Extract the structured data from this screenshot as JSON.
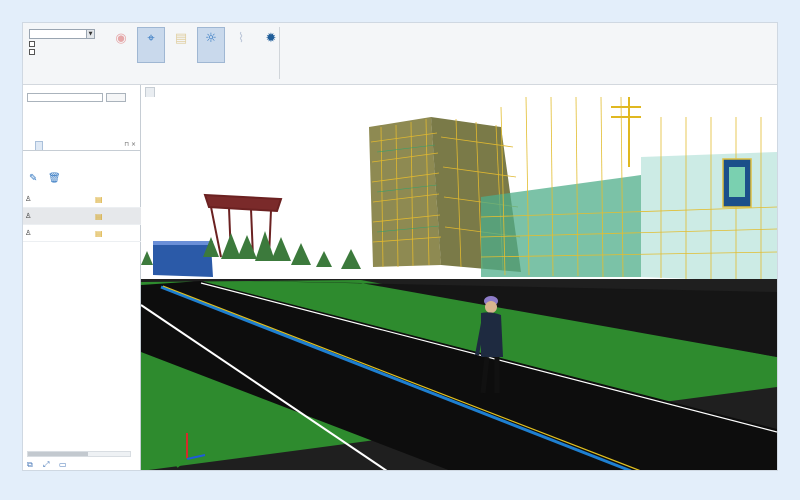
{
  "ribbon": {
    "view_select": "",
    "checkbox_1": "",
    "checkbox_2": "",
    "tools": [
      {
        "label": "",
        "icon": "record-icon",
        "state": "disabled"
      },
      {
        "label": "",
        "icon": "location-pin-icon",
        "state": "active"
      },
      {
        "label": "",
        "icon": "document-icon",
        "state": "disabled"
      },
      {
        "label": "",
        "icon": "lightbulb-icon",
        "state": "active"
      },
      {
        "label": "",
        "icon": "path-icon",
        "state": "disabled"
      },
      {
        "label": "",
        "icon": "settings-gear-icon",
        "state": "normal"
      }
    ],
    "group_label": ""
  },
  "left_panel": {
    "project_select": "",
    "action_button": "",
    "tree_item": "",
    "tabs": [
      "",
      ""
    ],
    "subheader": "",
    "rows": [
      {
        "name": "",
        "tail": ""
      },
      {
        "name": "",
        "tail": ""
      },
      {
        "name": "",
        "tail": ""
      }
    ]
  },
  "viewport": {
    "tab_label": ""
  },
  "colors": {
    "accent": "#1f5d99",
    "grass": "#2e8b2e",
    "road": "#111111",
    "lane_blue": "#1e7fd0",
    "lane_yellow": "#e0c020",
    "scaffold": "#d8b030"
  }
}
